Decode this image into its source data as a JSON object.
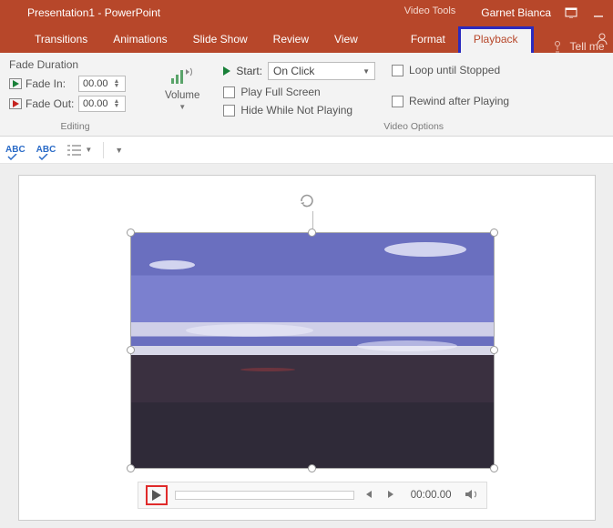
{
  "title": "Presentation1 - PowerPoint",
  "tools_tab_label": "Video Tools",
  "user_name": "Garnet Bianca",
  "tabs": {
    "transitions": "Transitions",
    "animations": "Animations",
    "slideshow": "Slide Show",
    "review": "Review",
    "view": "View",
    "format": "Format",
    "playback": "Playback",
    "tellme": "Tell me"
  },
  "ribbon": {
    "fade_title": "Fade Duration",
    "fade_in_label": "Fade In:",
    "fade_in_value": "00.00",
    "fade_out_label": "Fade Out:",
    "fade_out_value": "00.00",
    "editing_group": "Editing",
    "volume_label": "Volume",
    "start_label": "Start:",
    "start_value": "On Click",
    "play_full": "Play Full Screen",
    "hide_not_playing": "Hide While Not Playing",
    "loop": "Loop until Stopped",
    "rewind": "Rewind after Playing",
    "video_options_group": "Video Options"
  },
  "media": {
    "timecode": "00:00.00"
  }
}
